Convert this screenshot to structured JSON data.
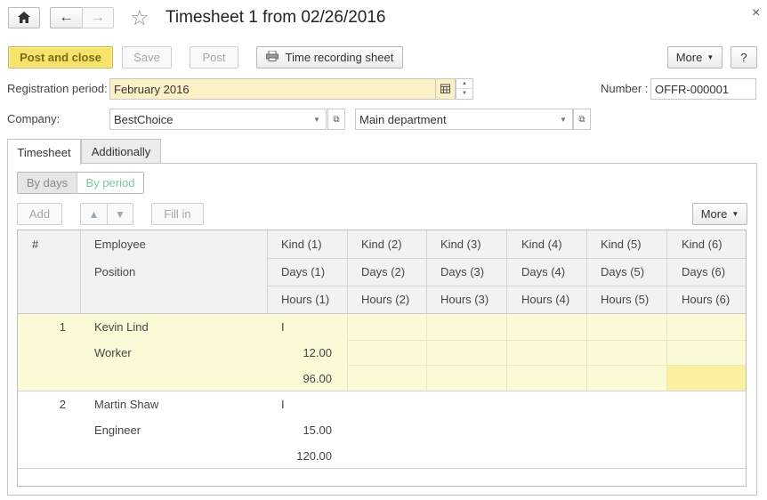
{
  "window": {
    "title": "Timesheet 1 from 02/26/2016",
    "close_glyph": "×"
  },
  "nav": {
    "home_icon": "⌂",
    "back_icon": "←",
    "forward_icon": "→",
    "favorite_icon": "☆"
  },
  "toolbar": {
    "post_close": "Post and close",
    "save": "Save",
    "post": "Post",
    "time_recording": "Time recording sheet",
    "more": "More",
    "help": "?"
  },
  "form": {
    "reg_period_label": "Registration period:",
    "reg_period_value": "February 2016",
    "number_label": "Number :",
    "number_value": "OFFR-000001",
    "company_label": "Company:",
    "company_value": "BestChoice",
    "department_value": "Main department"
  },
  "tabs": [
    {
      "label": "Timesheet",
      "active": true
    },
    {
      "label": "Additionally",
      "active": false
    }
  ],
  "view_toggle": {
    "by_days": "By days",
    "by_period": "By period"
  },
  "table_toolbar": {
    "add": "Add",
    "up_icon": "▲",
    "down_icon": "▼",
    "fill_in": "Fill in",
    "more": "More"
  },
  "table": {
    "header": {
      "num": "#",
      "employee": "Employee",
      "position": "Position",
      "kinds": [
        "Kind (1)",
        "Kind (2)",
        "Kind (3)",
        "Kind (4)",
        "Kind (5)",
        "Kind (6)"
      ],
      "days": [
        "Days (1)",
        "Days (2)",
        "Days (3)",
        "Days (4)",
        "Days (5)",
        "Days (6)"
      ],
      "hours": [
        "Hours (1)",
        "Hours (2)",
        "Hours (3)",
        "Hours (4)",
        "Hours (5)",
        "Hours (6)"
      ]
    },
    "rows": [
      {
        "num": "1",
        "employee": "Kevin Lind",
        "position": "Worker",
        "kind1": "I",
        "days1": "12.00",
        "hours1": "96.00",
        "selected": true
      },
      {
        "num": "2",
        "employee": "Martin Shaw",
        "position": "Engineer",
        "kind1": "I",
        "days1": "15.00",
        "hours1": "120.00",
        "selected": false
      }
    ]
  },
  "colors": {
    "accent_yellow": "#f6e36a",
    "row_selected": "#fdfbd7",
    "cell_active": "#fbf0a0",
    "header_bg": "#f2f2f2",
    "by_period_text": "#7bc8a0"
  }
}
